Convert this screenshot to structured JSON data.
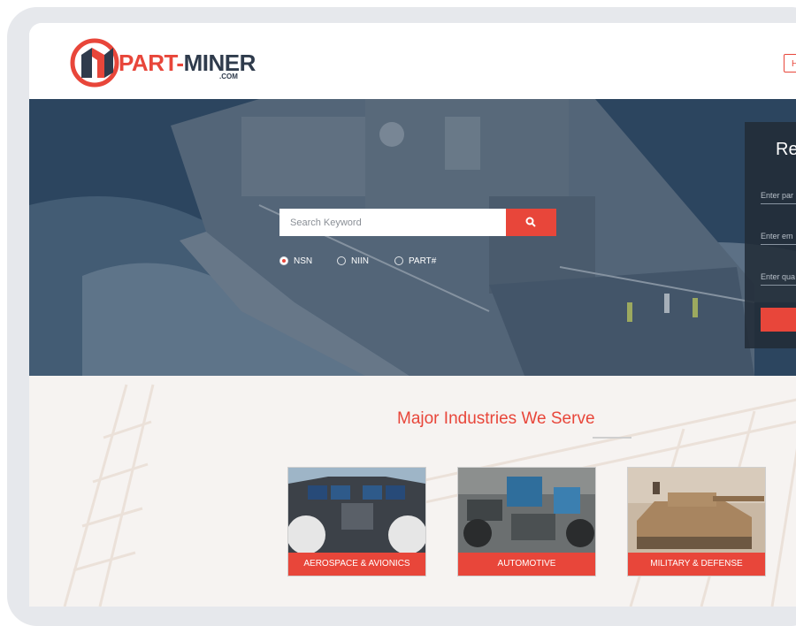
{
  "brand": {
    "logo_main": "PART-",
    "logo_rest": "MINER",
    "logo_sub": ".COM",
    "accent": "#e8463a",
    "dark": "#2f3b4c"
  },
  "header": {
    "button_label": "H"
  },
  "search": {
    "placeholder": "Search Keyword",
    "button_icon": "search-icon",
    "options": [
      {
        "label": "NSN",
        "selected": true
      },
      {
        "label": "NIIN",
        "selected": false
      },
      {
        "label": "PART#",
        "selected": false
      }
    ]
  },
  "rfq": {
    "title": "Re",
    "fields": [
      {
        "placeholder": "Enter par"
      },
      {
        "placeholder": "Enter em"
      },
      {
        "placeholder": "Enter qua"
      }
    ]
  },
  "industries": {
    "title": "Major Industries We Serve",
    "cards": [
      {
        "label": "AEROSPACE & AVIONICS",
        "image": "cockpit-image"
      },
      {
        "label": "AUTOMOTIVE",
        "image": "workshop-image"
      },
      {
        "label": "MILITARY & DEFENSE",
        "image": "tank-image"
      }
    ]
  }
}
